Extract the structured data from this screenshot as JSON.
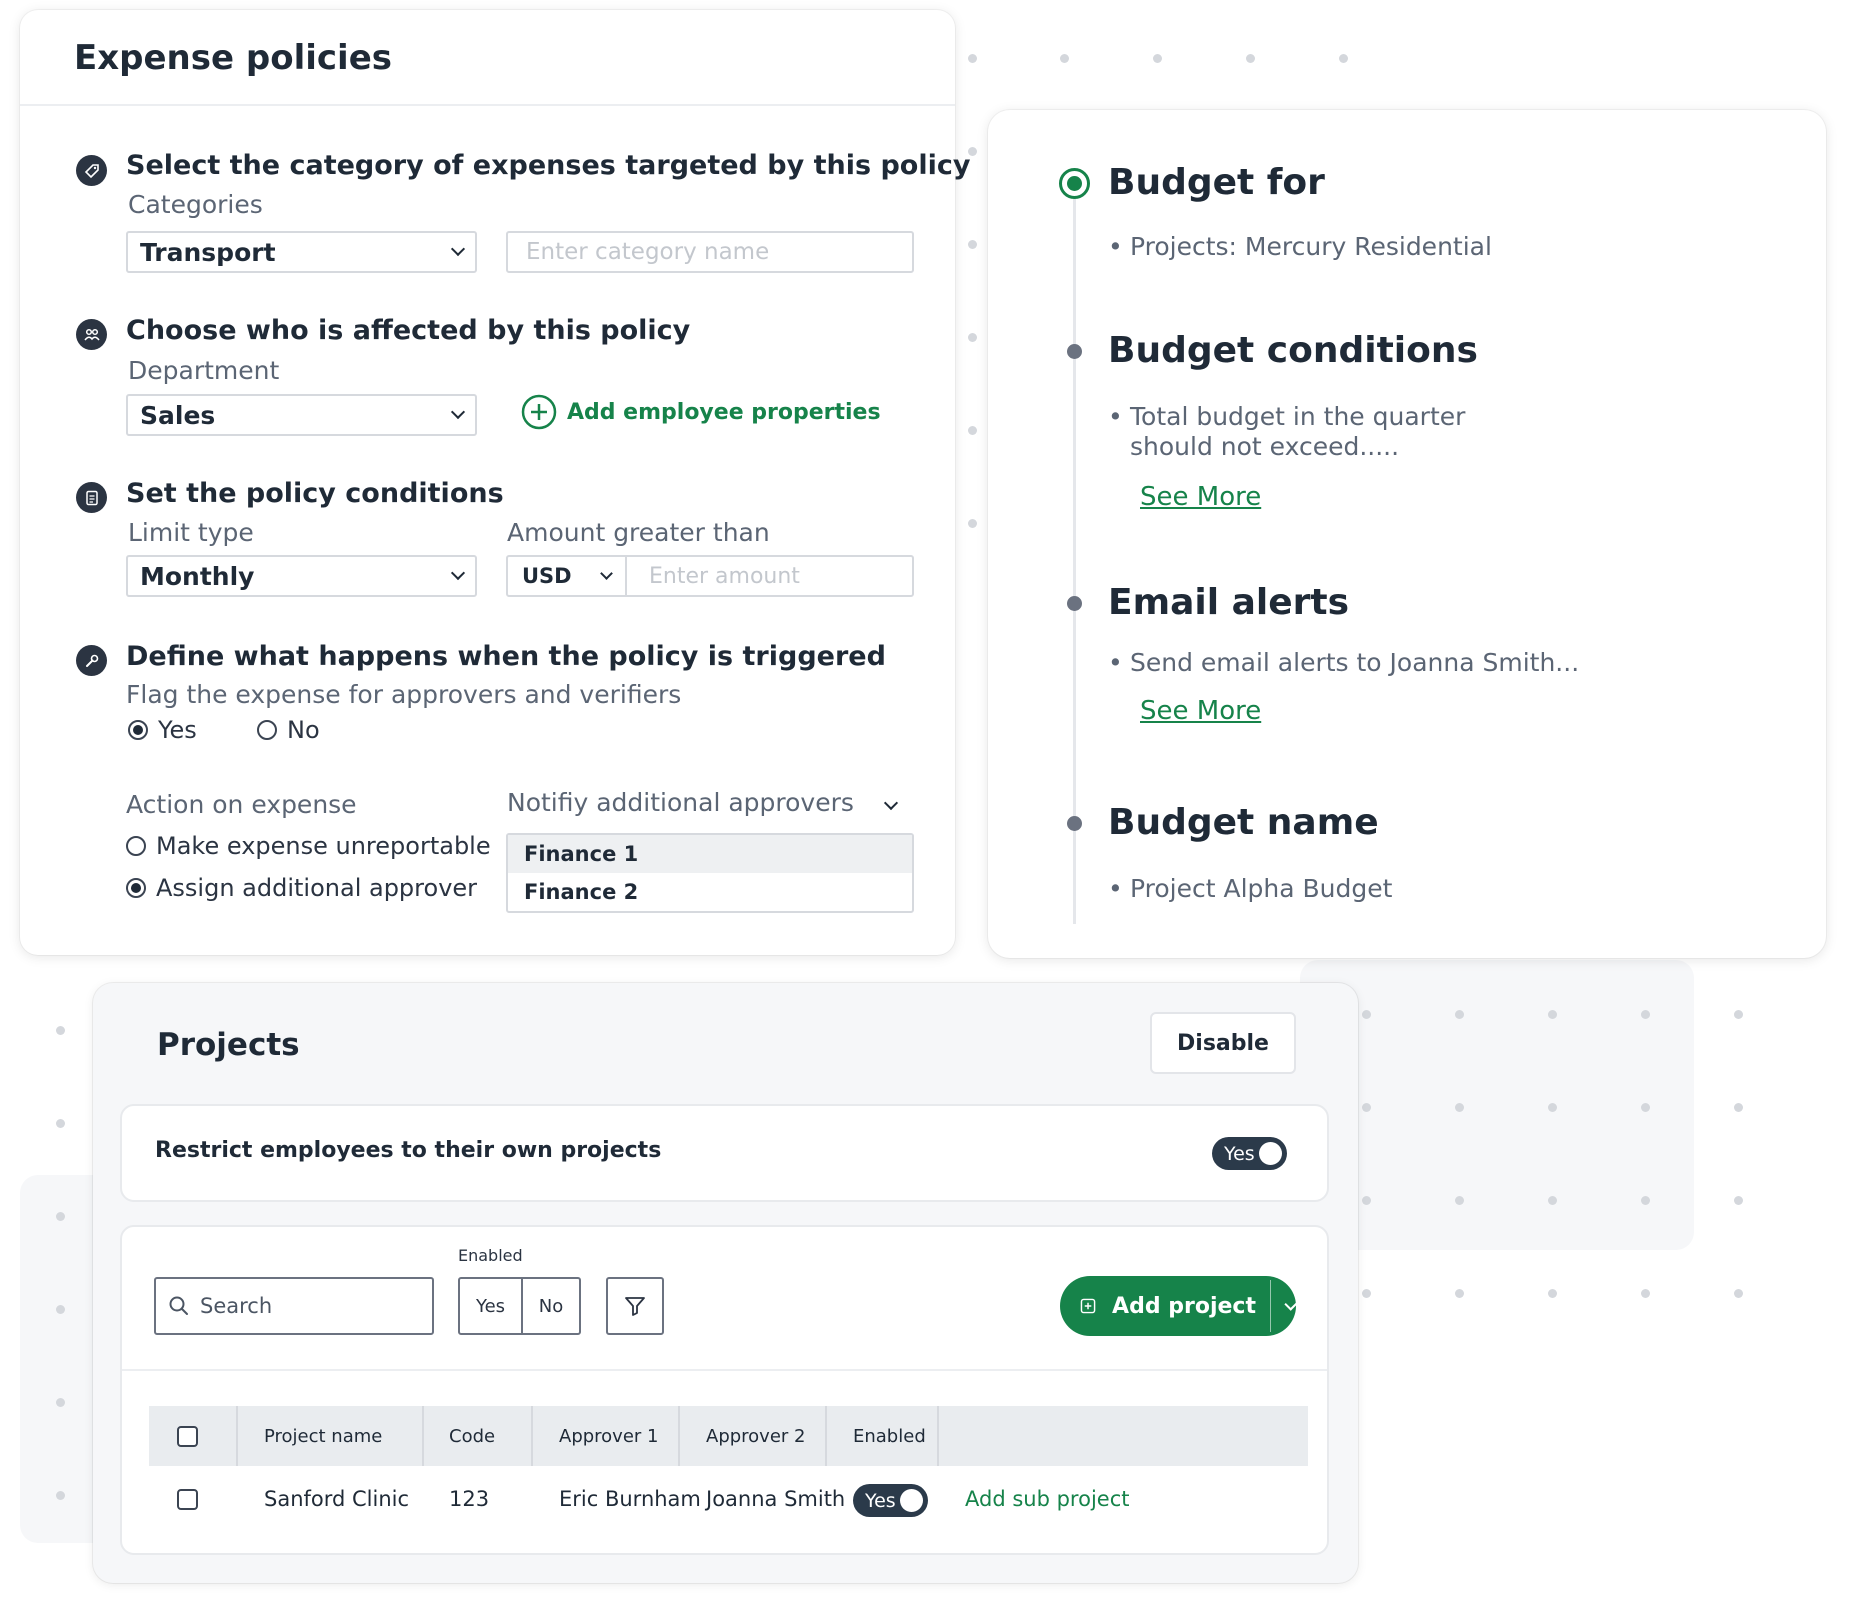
{
  "expense_policies": {
    "title": "Expense policies",
    "category_section": {
      "title": "Select the category of expenses targeted by this policy",
      "label": "Categories",
      "selected": "Transport",
      "placeholder": "Enter category name",
      "icon": "tag-icon"
    },
    "affected_section": {
      "title": "Choose who is affected by this policy",
      "label": "Department",
      "selected": "Sales",
      "add_link": "Add employee properties",
      "icon": "people-icon"
    },
    "conditions_section": {
      "title": "Set the policy conditions",
      "limit_label": "Limit type",
      "limit_selected": "Monthly",
      "amount_label": "Amount greater than",
      "currency": "USD",
      "amount_placeholder": "Enter amount",
      "icon": "document-icon"
    },
    "trigger_section": {
      "title": "Define what happens when the policy is triggered",
      "flag_label": "Flag the expense for approvers and verifiers",
      "flag_options": [
        "Yes",
        "No"
      ],
      "flag_selected": "Yes",
      "action_label": "Action on expense",
      "action_options": [
        "Make expense unreportable",
        "Assign additional approver"
      ],
      "action_selected": "Assign additional approver",
      "notify_label": "Notifiy additional approvers",
      "notify_options": [
        "Finance 1",
        "Finance 2"
      ],
      "notify_highlighted": "Finance 1",
      "icon": "wrench-icon"
    }
  },
  "budget_summary": {
    "items": [
      {
        "title": "Budget for",
        "text": "Projects: Mercury Residential",
        "active": true
      },
      {
        "title": "Budget conditions",
        "text_line1": "Total budget in the quarter",
        "text_line2": "should not exceed.....",
        "link": "See More"
      },
      {
        "title": "Email alerts",
        "text": "Send email alerts to Joanna Smith...",
        "link": "See More"
      },
      {
        "title": "Budget name",
        "text": "Project Alpha Budget"
      }
    ]
  },
  "projects": {
    "title": "Projects",
    "disable_label": "Disable",
    "restrict_label": "Restrict employees to their own projects",
    "restrict_toggle": "Yes",
    "search_placeholder": "Search",
    "enabled_filter_label": "Enabled",
    "enabled_options": [
      "Yes",
      "No"
    ],
    "add_project_label": "Add project",
    "columns": [
      "Project name",
      "Code",
      "Approver 1",
      "Approver 2",
      "Enabled"
    ],
    "rows": [
      {
        "name": "Sanford Clinic",
        "code": "123",
        "approver1": "Eric Burnham",
        "approver2": "Joanna Smith",
        "enabled": "Yes",
        "action": "Add sub project"
      }
    ]
  },
  "colors": {
    "accent_green": "#16834a",
    "dark_toggle": "#2b3a4a",
    "text_primary": "#1f2a37",
    "text_secondary": "#5b6574"
  }
}
